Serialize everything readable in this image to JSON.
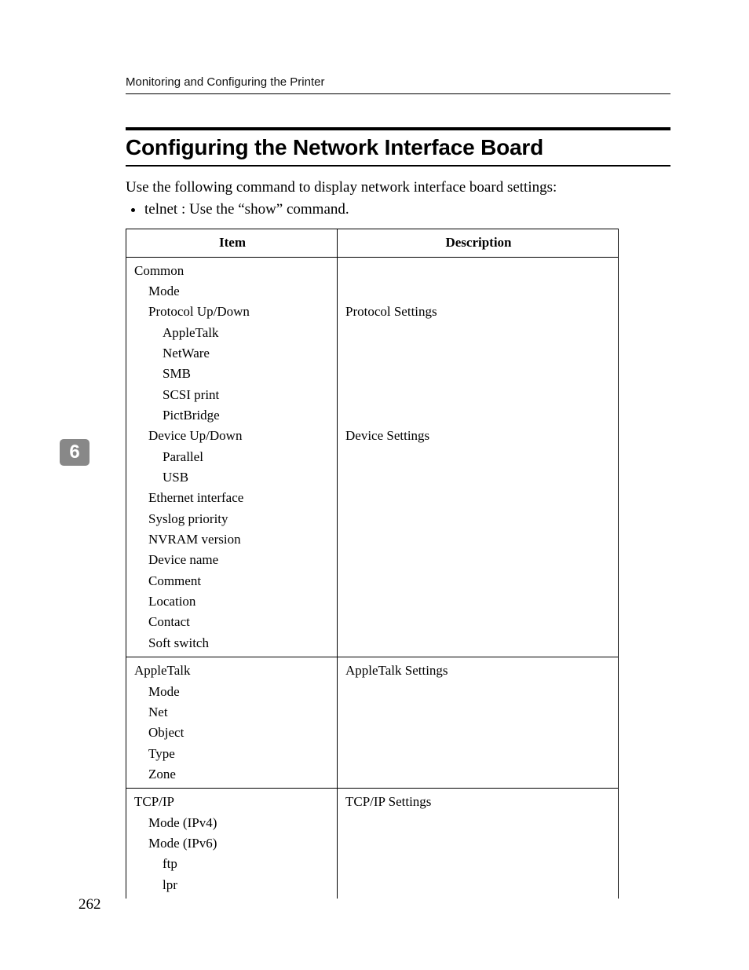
{
  "running_head": "Monitoring and Configuring the Printer",
  "section_title": "Configuring the Network Interface Board",
  "intro_paragraph": "Use the following command to display network interface board settings:",
  "bullets": [
    "telnet : Use the “show” command."
  ],
  "chapter_tab": "6",
  "page_number": "262",
  "table": {
    "headers": [
      "Item",
      "Description"
    ],
    "sections": [
      {
        "description_lines": [
          "",
          "",
          "Protocol Settings",
          "",
          "",
          "",
          "",
          "",
          "Device Settings",
          "",
          "",
          "",
          "",
          "",
          "",
          "",
          "",
          "",
          ""
        ],
        "item_lines": [
          {
            "indent": 0,
            "text": "Common"
          },
          {
            "indent": 1,
            "text": "Mode"
          },
          {
            "indent": 1,
            "text": "Protocol Up/Down"
          },
          {
            "indent": 2,
            "text": "AppleTalk"
          },
          {
            "indent": 2,
            "text": "NetWare"
          },
          {
            "indent": 2,
            "text": "SMB"
          },
          {
            "indent": 2,
            "text": "SCSI print"
          },
          {
            "indent": 2,
            "text": "PictBridge"
          },
          {
            "indent": 1,
            "text": "Device Up/Down"
          },
          {
            "indent": 2,
            "text": "Parallel"
          },
          {
            "indent": 2,
            "text": "USB"
          },
          {
            "indent": 1,
            "text": "Ethernet interface"
          },
          {
            "indent": 1,
            "text": "Syslog priority"
          },
          {
            "indent": 1,
            "text": "NVRAM version"
          },
          {
            "indent": 1,
            "text": "Device name"
          },
          {
            "indent": 1,
            "text": "Comment"
          },
          {
            "indent": 1,
            "text": "Location"
          },
          {
            "indent": 1,
            "text": "Contact"
          },
          {
            "indent": 1,
            "text": "Soft switch"
          }
        ]
      },
      {
        "description_lines": [
          "AppleTalk Settings",
          "",
          "",
          "",
          "",
          ""
        ],
        "item_lines": [
          {
            "indent": 0,
            "text": "AppleTalk"
          },
          {
            "indent": 1,
            "text": "Mode"
          },
          {
            "indent": 1,
            "text": "Net"
          },
          {
            "indent": 1,
            "text": "Object"
          },
          {
            "indent": 1,
            "text": "Type"
          },
          {
            "indent": 1,
            "text": "Zone"
          }
        ]
      },
      {
        "description_lines": [
          "TCP/IP Settings",
          "",
          "",
          "",
          ""
        ],
        "item_lines": [
          {
            "indent": 0,
            "text": "TCP/IP"
          },
          {
            "indent": 1,
            "text": "Mode (IPv4)"
          },
          {
            "indent": 1,
            "text": "Mode (IPv6)"
          },
          {
            "indent": 2,
            "text": "ftp"
          },
          {
            "indent": 2,
            "text": "lpr"
          }
        ],
        "open_bottom": true
      }
    ]
  }
}
